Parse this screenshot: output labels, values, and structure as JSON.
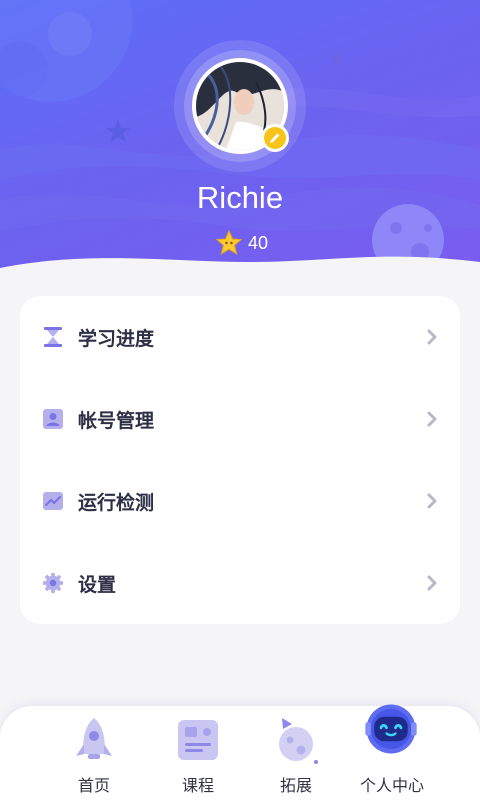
{
  "profile": {
    "username": "Richie",
    "star_count": "40",
    "avatar_icon": "avatar-photo",
    "edit_icon": "pencil-icon"
  },
  "menu": {
    "items": [
      {
        "label": "学习进度",
        "icon": "hourglass-icon"
      },
      {
        "label": "帐号管理",
        "icon": "person-card-icon"
      },
      {
        "label": "运行检测",
        "icon": "trend-chart-icon"
      },
      {
        "label": "设置",
        "icon": "gear-icon"
      }
    ]
  },
  "tabbar": {
    "tabs": [
      {
        "label": "首页",
        "icon": "rocket-icon",
        "active": false
      },
      {
        "label": "课程",
        "icon": "book-board-icon",
        "active": false
      },
      {
        "label": "拓展",
        "icon": "planet-flag-icon",
        "active": false
      },
      {
        "label": "个人中心",
        "icon": "robot-icon",
        "active": true
      }
    ]
  },
  "colors": {
    "header_gradient_start": "#5b6ff7",
    "header_gradient_end": "#7a5cf0",
    "accent_purple": "#6b63f0",
    "star_yellow": "#f9c41a",
    "text_dark": "#2c2f45",
    "icon_lavender": "#b3b0ec"
  }
}
